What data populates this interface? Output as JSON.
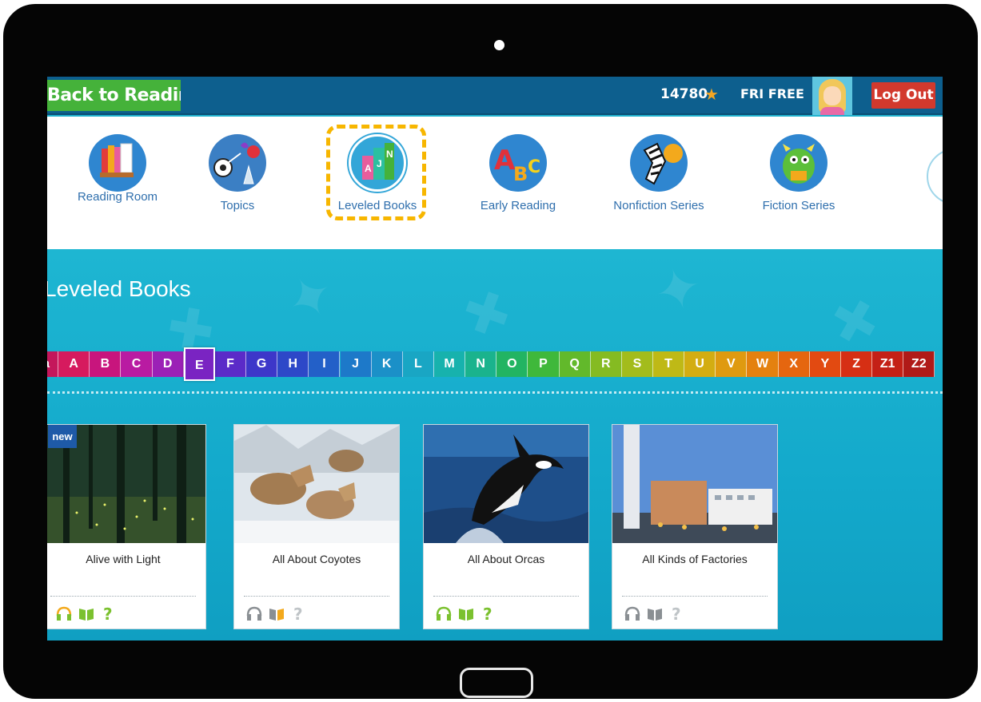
{
  "topbar": {
    "back_label": "Back to Reading",
    "points": "14780",
    "plan": "FRI FREE",
    "logout_label": "Log Out"
  },
  "categories": [
    {
      "label": "Reading Room",
      "icon": "books-shelf-icon",
      "color": "#2f86d0"
    },
    {
      "label": "Topics",
      "icon": "globe-topics-icon",
      "color": "#3b7fc4"
    },
    {
      "label": "Leveled Books",
      "icon": "leveled-books-icon",
      "color": "#33a6d8",
      "selected": true
    },
    {
      "label": "Early Reading",
      "icon": "abc-blocks-icon",
      "color": "#2f86d0"
    },
    {
      "label": "Nonfiction Series",
      "icon": "zebra-icon",
      "color": "#2f86d0"
    },
    {
      "label": "Fiction Series",
      "icon": "monster-icon",
      "color": "#2f86d0"
    }
  ],
  "section_title": "Leveled Books",
  "levels": [
    {
      "label": "aa",
      "color": "#c4175b"
    },
    {
      "label": "A",
      "color": "#d61a5e"
    },
    {
      "label": "B",
      "color": "#c8157d"
    },
    {
      "label": "C",
      "color": "#b91ba2"
    },
    {
      "label": "D",
      "color": "#9b21b6"
    },
    {
      "label": "E",
      "color": "#7a24c2",
      "active": true
    },
    {
      "label": "F",
      "color": "#5b2bc8"
    },
    {
      "label": "G",
      "color": "#3d37c9"
    },
    {
      "label": "H",
      "color": "#2d48c8"
    },
    {
      "label": "I",
      "color": "#2360c8"
    },
    {
      "label": "J",
      "color": "#1d79c9"
    },
    {
      "label": "K",
      "color": "#1b90c8"
    },
    {
      "label": "L",
      "color": "#19a6c4"
    },
    {
      "label": "M",
      "color": "#17b2ad"
    },
    {
      "label": "N",
      "color": "#1ab38d"
    },
    {
      "label": "O",
      "color": "#22b462"
    },
    {
      "label": "P",
      "color": "#3fb83b"
    },
    {
      "label": "Q",
      "color": "#62b92b"
    },
    {
      "label": "R",
      "color": "#85bb22"
    },
    {
      "label": "S",
      "color": "#a3bc1c"
    },
    {
      "label": "T",
      "color": "#bfb916"
    },
    {
      "label": "U",
      "color": "#d3ad12"
    },
    {
      "label": "V",
      "color": "#df9a10"
    },
    {
      "label": "W",
      "color": "#e4810f"
    },
    {
      "label": "X",
      "color": "#e5660f"
    },
    {
      "label": "Y",
      "color": "#e24a11"
    },
    {
      "label": "Z",
      "color": "#d62f14"
    },
    {
      "label": "Z1",
      "color": "#c42016"
    },
    {
      "label": "Z2",
      "color": "#b01a18"
    }
  ],
  "books": [
    {
      "title": "Alive with Light",
      "badge": "new",
      "thumb": "forest",
      "actions": [
        "listen-read-icon",
        "read-icon",
        "quiz-icon"
      ],
      "active_actions": true
    },
    {
      "title": "All About Coyotes",
      "thumb": "coyotes",
      "actions": [
        "listen-icon",
        "read-icon",
        "quiz-icon"
      ],
      "active_actions": false
    },
    {
      "title": "All About Orcas",
      "thumb": "orca",
      "actions": [
        "listen-read-icon",
        "read-icon",
        "quiz-icon"
      ],
      "active_actions": true
    },
    {
      "title": "All Kinds of Factories",
      "thumb": "factory",
      "actions": [
        "listen-icon",
        "read-icon",
        "quiz-icon"
      ],
      "active_actions": false
    }
  ],
  "colors": {
    "topbar": "#0d5f8e",
    "back_button": "#45b23a",
    "logout_button": "#d2392d",
    "highlight": "#f7b600",
    "content_bg": "#1eb6d2",
    "action_active": "#7bc12f",
    "action_inactive": "#8a8f93"
  }
}
